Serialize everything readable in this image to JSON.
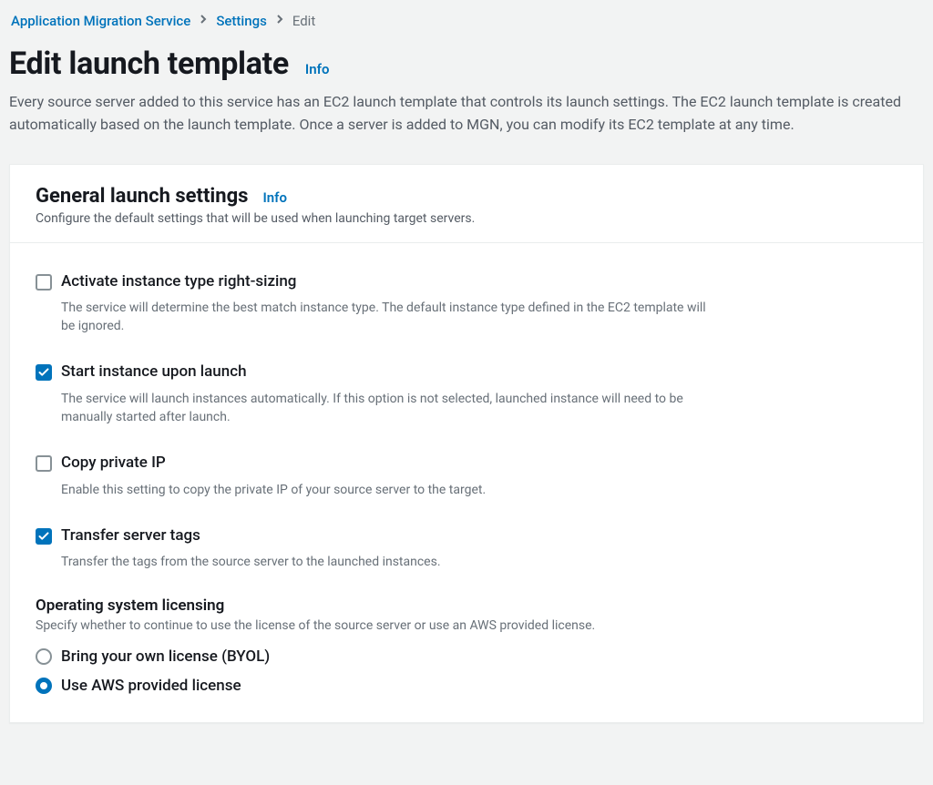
{
  "breadcrumbs": {
    "root": "Application Migration Service",
    "mid": "Settings",
    "current": "Edit"
  },
  "header": {
    "title": "Edit launch template",
    "info": "Info",
    "description": "Every source server added to this service has an EC2 launch template that controls its launch settings. The EC2 launch template is created automatically based on the launch template. Once a server is added to MGN, you can modify its EC2 template at any time."
  },
  "panel": {
    "title": "General launch settings",
    "info": "Info",
    "subtitle": "Configure the default settings that will be used when launching target servers."
  },
  "options": {
    "rightsizing": {
      "label": "Activate instance type right-sizing",
      "desc": "The service will determine the best match instance type. The default instance type defined in the EC2 template will be ignored.",
      "checked": false
    },
    "start": {
      "label": "Start instance upon launch",
      "desc": "The service will launch instances automatically. If this option is not selected, launched instance will need to be manually started after launch.",
      "checked": true
    },
    "copyip": {
      "label": "Copy private IP",
      "desc": "Enable this setting to copy the private IP of your source server to the target.",
      "checked": false
    },
    "tags": {
      "label": "Transfer server tags",
      "desc": "Transfer the tags from the source server to the launched instances.",
      "checked": true
    }
  },
  "licensing": {
    "heading": "Operating system licensing",
    "desc": "Specify whether to continue to use the license of the source server or use an AWS provided license.",
    "byol": "Bring your own license (BYOL)",
    "aws": "Use AWS provided license",
    "selected": "aws"
  }
}
